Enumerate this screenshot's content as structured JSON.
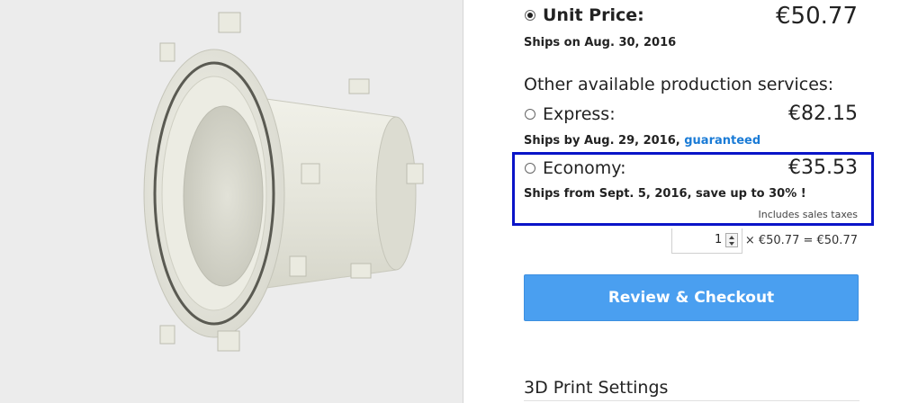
{
  "pricing": {
    "unit_label": "Unit Price:",
    "unit_price": "€50.77",
    "unit_ships": "Ships on Aug. 30, 2016"
  },
  "other_services": {
    "heading": "Other available production services:",
    "express": {
      "label": "Express:",
      "price": "€82.15",
      "ships": "Ships by Aug. 29, 2016,",
      "link": "guaranteed"
    },
    "economy": {
      "label": "Economy:",
      "price": "€35.53",
      "ships": "Ships from Sept. 5, 2016, save up to 30% !",
      "taxes": "Includes sales taxes"
    }
  },
  "quantity": {
    "value": "1",
    "calculation": "× €50.77 = €50.77"
  },
  "checkout_label": "Review & Checkout",
  "print_settings_heading": "3D Print Settings",
  "colors": {
    "highlight_border": "#0a14c8",
    "checkout_button": "#4a9ff0",
    "link": "#1a7bd6"
  }
}
